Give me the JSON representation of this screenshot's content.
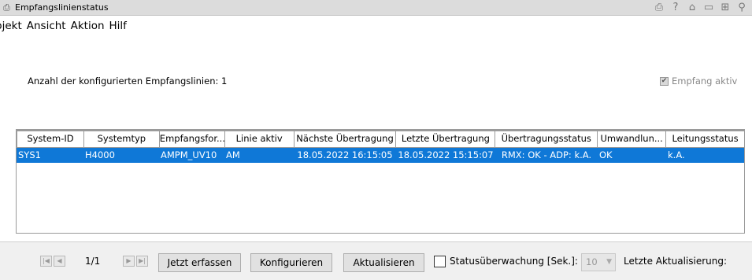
{
  "window": {
    "title": "Empfangslinienstatus"
  },
  "menu": {
    "items": [
      "bjekt",
      "Ansicht",
      "Aktion",
      "Hilf"
    ]
  },
  "info": {
    "label": "Anzahl der konfigurierten Empfangslinien: 1",
    "empfang_checkbox": "Empfang aktiv",
    "empfang_checked": true
  },
  "table": {
    "columns": [
      "System-ID",
      "Systemtyp",
      "Empfangsfor...",
      "Linie aktiv",
      "Nächste Übertragung",
      "Letzte Übertragung",
      "Übertragungsstatus",
      "Umwandlun...",
      "Leitungsstatus"
    ],
    "rows": [
      [
        "SYS1",
        "H4000",
        "AMPM_UV10",
        "AM",
        "18.05.2022 16:15:05",
        "18.05.2022 15:15:07",
        "RMX: OK - ADP: k.A.",
        "OK",
        "k.A."
      ]
    ]
  },
  "footer": {
    "page": "1/1",
    "btn_capture": "Jetzt erfassen",
    "btn_configure": "Konfigurieren",
    "btn_refresh": "Aktualisieren",
    "status_monitor_label": "Statusüberwachung [Sek.]:",
    "status_monitor_checked": false,
    "interval_value": "10",
    "last_update_label": "Letzte Aktualisierung:"
  }
}
